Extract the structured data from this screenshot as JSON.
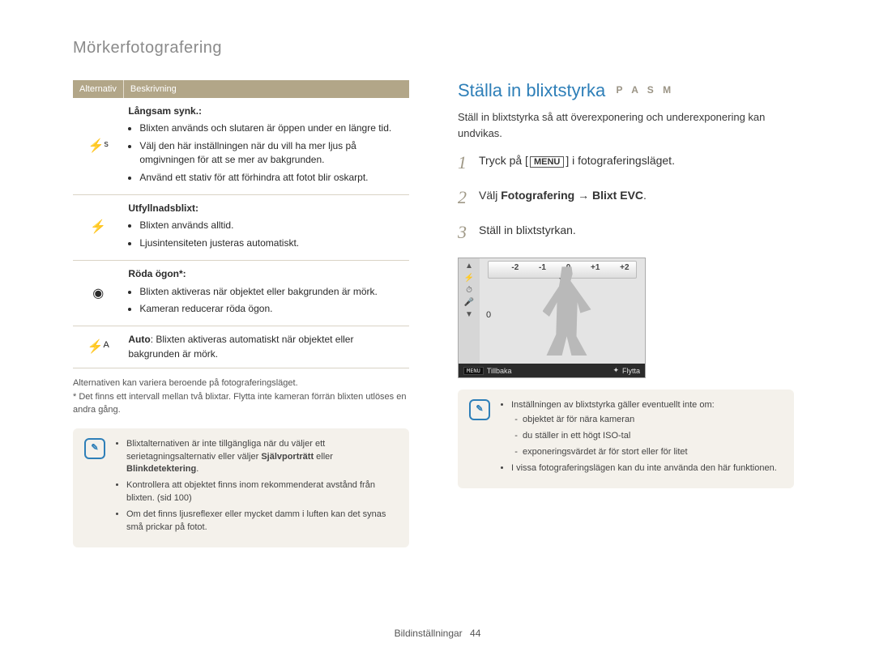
{
  "breadcrumb": "Mörkerfotografering",
  "left": {
    "table_header_alt": "Alternativ",
    "table_header_desc": "Beskrivning",
    "rows": [
      {
        "icon_name": "flash-slow-sync-icon",
        "icon_glyph": "⚡ˢ",
        "title": "Långsam synk.:",
        "bullets": [
          "Blixten används och slutaren är öppen under en längre tid.",
          "Välj den här inställningen när du vill ha mer ljus på omgivningen för att se mer av bakgrunden.",
          "Använd ett stativ för att förhindra att fotot blir oskarpt."
        ]
      },
      {
        "icon_name": "flash-fill-icon",
        "icon_glyph": "⚡",
        "title": "Utfyllnadsblixt:",
        "bullets": [
          "Blixten används alltid.",
          "Ljusintensiteten justeras automatiskt."
        ]
      },
      {
        "icon_name": "red-eye-icon",
        "icon_glyph": "◉",
        "title": "Röda ögon*:",
        "bullets": [
          "Blixten aktiveras när objektet eller bakgrunden är mörk.",
          "Kameran reducerar röda ögon."
        ]
      },
      {
        "icon_name": "flash-auto-icon",
        "icon_glyph": "⚡ᴬ",
        "title": "",
        "plain_prefix": "Auto",
        "plain": ": Blixten aktiveras automatiskt när objektet eller bakgrunden är mörk.",
        "bullets": []
      }
    ],
    "small_notes": [
      "Alternativen kan variera beroende på fotograferingsläget.",
      "* Det finns ett intervall mellan två blixtar. Flytta inte kameran förrän blixten utlöses en andra gång."
    ],
    "notebox": [
      {
        "type": "li",
        "parts": [
          {
            "t": "Blixtalternativen är inte tillgängliga när du väljer ett serietagningsalternativ eller väljer ",
            "b": false
          },
          {
            "t": "Självporträtt",
            "b": true
          },
          {
            "t": " eller ",
            "b": false
          },
          {
            "t": "Blinkdetektering",
            "b": true
          },
          {
            "t": ".",
            "b": false
          }
        ]
      },
      {
        "type": "li",
        "parts": [
          {
            "t": "Kontrollera att objektet finns inom rekommenderat avstånd från blixten. (sid 100)",
            "b": false
          }
        ]
      },
      {
        "type": "li",
        "parts": [
          {
            "t": "Om det finns ljusreflexer eller mycket damm i luften kan det synas små prickar på fotot.",
            "b": false
          }
        ]
      }
    ]
  },
  "right": {
    "title": "Ställa in blixtstyrka",
    "modes": "P A S M",
    "intro": "Ställ in blixtstyrka så att överexponering och underexponering kan undvikas.",
    "steps": [
      {
        "pre": "Tryck på [",
        "btn": "MENU",
        "post": "] i fotograferingsläget."
      },
      {
        "text_pre": "Välj ",
        "bold": "Fotografering → Blixt EVC",
        "text_post": "."
      },
      {
        "plain": "Ställ in blixtstyrkan."
      }
    ],
    "lcd": {
      "ev_labels": [
        "-2",
        "-1",
        "0",
        "+1",
        "+2"
      ],
      "ev_value": "0",
      "side_icons": [
        "flash-icon",
        "timer-icon",
        "mic-off-icon"
      ],
      "back_label": "Tillbaka",
      "move_label": "Flytta"
    },
    "notebox": {
      "lead": "Inställningen av blixtstyrka gäller eventuellt inte om:",
      "dashes": [
        "objektet är för nära kameran",
        "du ställer in ett högt ISO-tal",
        "exponeringsvärdet är för stort eller för litet"
      ],
      "bullet2": "I vissa fotograferingslägen kan du inte använda den här funktionen."
    }
  },
  "footer": {
    "section": "Bildinställningar",
    "page": "44"
  }
}
